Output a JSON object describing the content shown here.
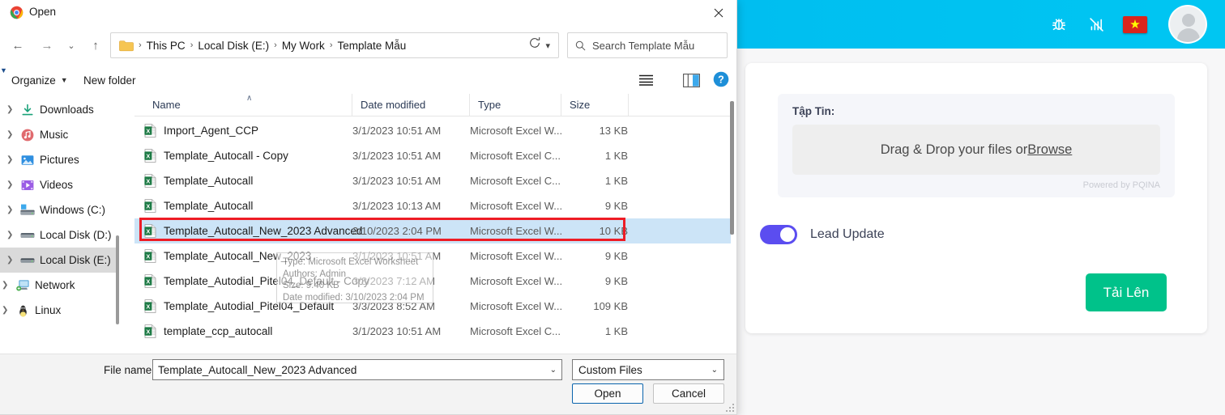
{
  "webapp": {
    "header": {
      "icons": [
        {
          "name": "bug-icon",
          "glyph": "🐞"
        },
        {
          "name": "signal-off-icon",
          "glyph": "📶"
        },
        {
          "name": "flag-vietnam-icon",
          "glyph": "★"
        }
      ]
    },
    "card": {
      "file_label": "Tập Tin:",
      "dropzone_text": "Drag & Drop your files or ",
      "dropzone_link": "Browse",
      "powered_by": "Powered by PQINA",
      "toggle_label": "Lead Update",
      "toggle_state": "on",
      "upload_button": "Tải Lên"
    },
    "colors": {
      "header_blue": "#00bdf0",
      "upload_green": "#00c28a",
      "toggle_purple": "#5b4df0"
    }
  },
  "dialog": {
    "title": "Open",
    "title_icon": "chrome-icon",
    "close_label": "✕",
    "nav": {
      "back": "←",
      "forward": "→",
      "recent": "⌄",
      "up": "↑",
      "refresh": "⟳"
    },
    "breadcrumb": {
      "segments": [
        "This PC",
        "Local Disk (E:)",
        "My Work",
        "Template Mẫu"
      ],
      "separator": "›"
    },
    "search": {
      "placeholder": "Search Template Mẫu"
    },
    "commands": {
      "organize": "Organize",
      "new_folder": "New folder",
      "caret": "▼",
      "view_icon": "view-list-icon",
      "pane_icon": "preview-pane-icon",
      "help_icon": "help-icon"
    },
    "nav_tree": [
      {
        "label": "Downloads",
        "icon": "downloads-icon",
        "indent": false,
        "selected": false
      },
      {
        "label": "Music",
        "icon": "music-icon",
        "indent": false,
        "selected": false
      },
      {
        "label": "Pictures",
        "icon": "pictures-icon",
        "indent": false,
        "selected": false
      },
      {
        "label": "Videos",
        "icon": "videos-icon",
        "indent": false,
        "selected": false
      },
      {
        "label": "Windows (C:)",
        "icon": "drive-windows-icon",
        "indent": false,
        "selected": false
      },
      {
        "label": "Local Disk (D:)",
        "icon": "drive-icon",
        "indent": false,
        "selected": false
      },
      {
        "label": "Local Disk (E:)",
        "icon": "drive-icon",
        "indent": false,
        "selected": true
      },
      {
        "label": "Network",
        "icon": "network-icon",
        "indent": true,
        "selected": false
      },
      {
        "label": "Linux",
        "icon": "linux-icon",
        "indent": true,
        "selected": false
      }
    ],
    "columns": {
      "name": "Name",
      "date_modified": "Date modified",
      "type": "Type",
      "size": "Size",
      "sort_arrow": "∧"
    },
    "files": [
      {
        "name": "Import_Agent_CCP",
        "date": "3/1/2023 10:51 AM",
        "type": "Microsoft Excel W...",
        "size": "13 KB",
        "selected": false
      },
      {
        "name": "Template_Autocall - Copy",
        "date": "3/1/2023 10:51 AM",
        "type": "Microsoft Excel C...",
        "size": "1 KB",
        "selected": false
      },
      {
        "name": "Template_Autocall",
        "date": "3/1/2023 10:51 AM",
        "type": "Microsoft Excel C...",
        "size": "1 KB",
        "selected": false
      },
      {
        "name": "Template_Autocall",
        "date": "3/1/2023 10:13 AM",
        "type": "Microsoft Excel W...",
        "size": "9 KB",
        "selected": false
      },
      {
        "name": "Template_Autocall_New_2023 Advanced",
        "date": "3/10/2023 2:04 PM",
        "type": "Microsoft Excel W...",
        "size": "10 KB",
        "selected": true
      },
      {
        "name": "Template_Autocall_New_2023",
        "date": "3/1/2023 10:51 AM",
        "type": "Microsoft Excel W...",
        "size": "9 KB",
        "selected": false
      },
      {
        "name": "Template_Autodial_Pitel04_Default - Copy",
        "date": "3/8/2023 7:12 AM",
        "type": "Microsoft Excel W...",
        "size": "9 KB",
        "selected": false
      },
      {
        "name": "Template_Autodial_Pitel04_Default",
        "date": "3/3/2023 8:52 AM",
        "type": "Microsoft Excel W...",
        "size": "109 KB",
        "selected": false
      },
      {
        "name": "template_ccp_autocall",
        "date": "3/1/2023 10:51 AM",
        "type": "Microsoft Excel C...",
        "size": "1 KB",
        "selected": false
      }
    ],
    "tooltip": {
      "line1": "Type: Microsoft Excel Worksheet",
      "line2": "Authors: Admin",
      "line3": "Size: 9.40 KB",
      "line4": "Date modified: 3/10/2023 2:04 PM"
    },
    "footer": {
      "filename_label": "File name:",
      "filename_value": "Template_Autocall_New_2023 Advanced",
      "filter_value": "Custom Files",
      "open_button": "Open",
      "cancel_button": "Cancel",
      "caret": "⌄"
    },
    "highlight_color": "#ee1c25"
  }
}
